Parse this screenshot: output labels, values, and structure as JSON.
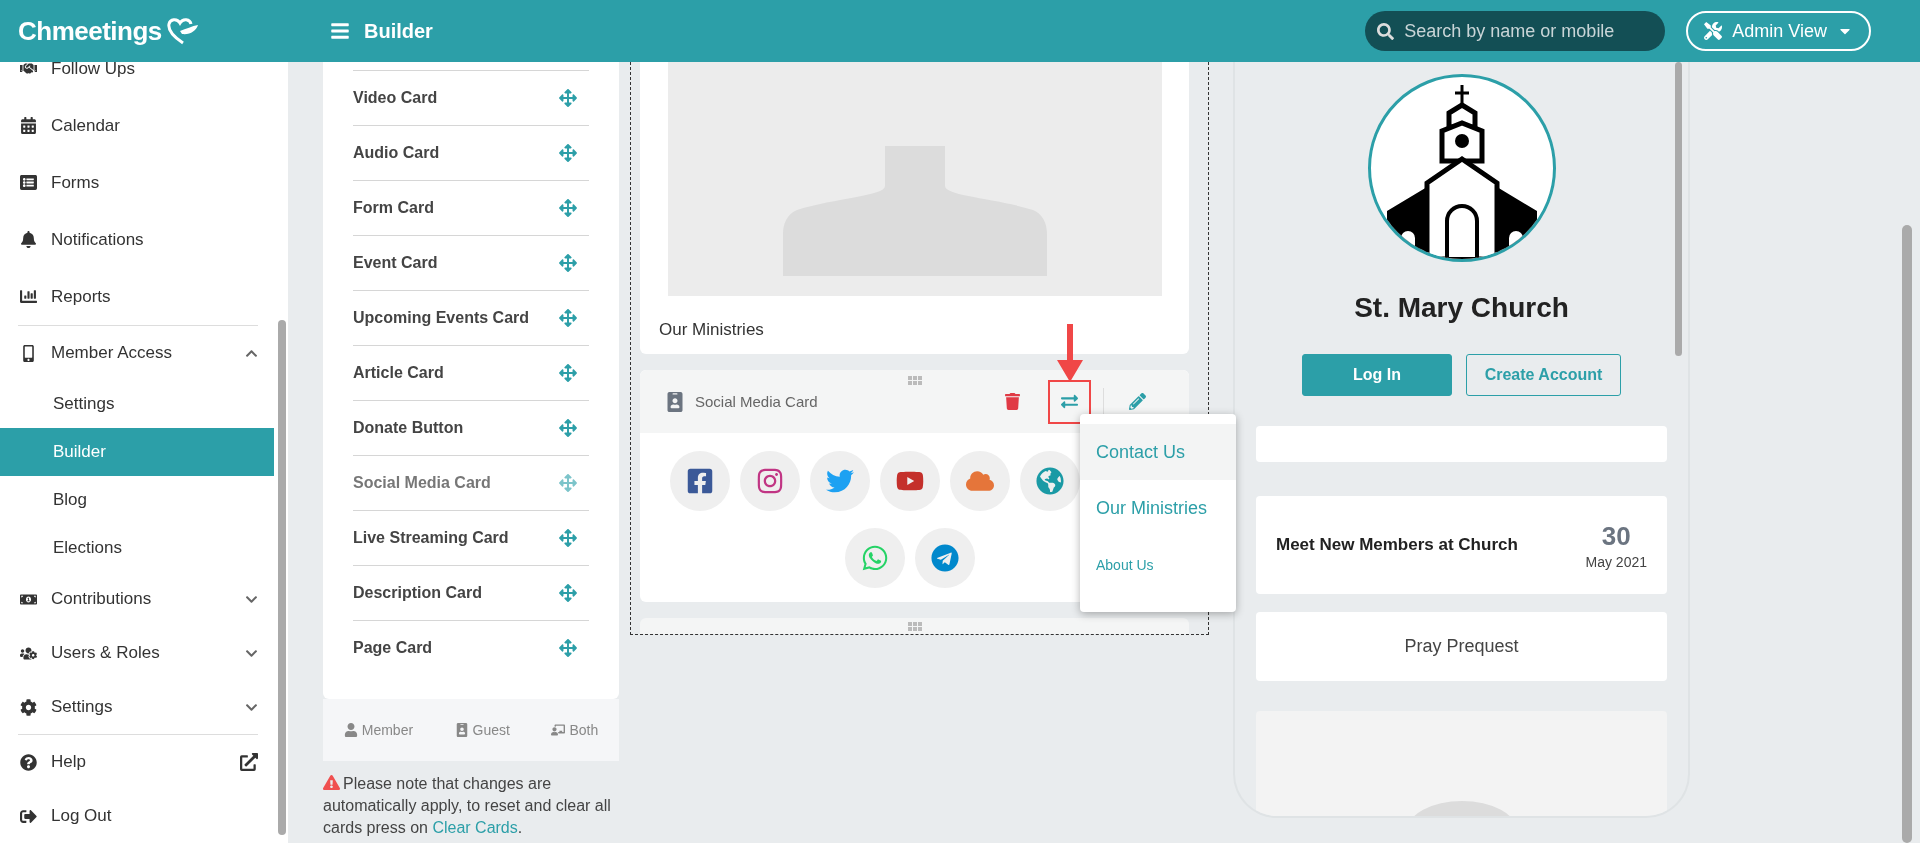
{
  "header": {
    "logo": "Chmeetings",
    "title": "Builder",
    "search": {
      "placeholder": "Search by name or mobile"
    },
    "view_menu": "Admin View"
  },
  "sidebar": {
    "sections": [
      [
        {
          "label": "Follow Ups",
          "selected": false
        },
        {
          "label": "Calendar",
          "selected": false
        },
        {
          "label": "Forms",
          "selected": false
        },
        {
          "label": "Notifications",
          "selected": false
        },
        {
          "label": "Reports",
          "selected": false
        }
      ],
      [
        {
          "label": "Member Access",
          "selected": false,
          "expanded": true,
          "children": [
            {
              "label": "Settings",
              "selected": false
            },
            {
              "label": "Builder",
              "selected": true
            },
            {
              "label": "Blog",
              "selected": false
            },
            {
              "label": "Elections",
              "selected": false
            }
          ]
        },
        {
          "label": "Contributions",
          "selected": false,
          "expanded": false
        },
        {
          "label": "Users & Roles",
          "selected": false,
          "expanded": false
        },
        {
          "label": "Settings",
          "selected": false,
          "expanded": false
        }
      ],
      [
        {
          "label": "Help",
          "selected": false,
          "external": true
        },
        {
          "label": "Log Out",
          "selected": false
        }
      ]
    ]
  },
  "card_types": [
    {
      "label": "Video Card",
      "disabled": false
    },
    {
      "label": "Audio Card",
      "disabled": false
    },
    {
      "label": "Form Card",
      "disabled": false
    },
    {
      "label": "Event Card",
      "disabled": false
    },
    {
      "label": "Upcoming Events Card",
      "disabled": false
    },
    {
      "label": "Article Card",
      "disabled": false
    },
    {
      "label": "Donate Button",
      "disabled": false
    },
    {
      "label": "Social Media Card",
      "disabled": true
    },
    {
      "label": "Live Streaming Card",
      "disabled": false
    },
    {
      "label": "Description Card",
      "disabled": false
    },
    {
      "label": "Page Card",
      "disabled": false
    }
  ],
  "legend": [
    "Member",
    "Guest",
    "Both"
  ],
  "note": {
    "text": "Please note that changes are automatically apply, to reset and clear all cards press on ",
    "link": "Clear Cards",
    "end": "."
  },
  "canvas": {
    "cards": [
      {
        "kind": "image",
        "caption": "Our Ministries"
      },
      {
        "kind": "social",
        "title": "Social Media Card",
        "actions": [
          {
            "kind": "delete",
            "highlighted": false
          },
          {
            "kind": "swap",
            "highlighted": true
          },
          {
            "kind": "edit",
            "highlighted": false
          }
        ]
      },
      {
        "kind": "stub"
      }
    ]
  },
  "page_menu": {
    "items": [
      {
        "label": "Contact Us",
        "selected": true
      },
      {
        "label": "Our Ministries",
        "selected": false
      },
      {
        "label": "About Us",
        "selected": false
      }
    ]
  },
  "preview": {
    "church_name": "St. Mary Church",
    "buttons": [
      {
        "label": "Log In",
        "kind": "primary"
      },
      {
        "label": "Create Account",
        "kind": "outline"
      }
    ],
    "blocks": [
      {
        "kind": "blank"
      },
      {
        "kind": "event",
        "title": "Meet New Members at Church",
        "day": "30",
        "month": "May 2021"
      },
      {
        "kind": "text",
        "label": "Pray Prequest"
      },
      {
        "kind": "image"
      }
    ]
  }
}
